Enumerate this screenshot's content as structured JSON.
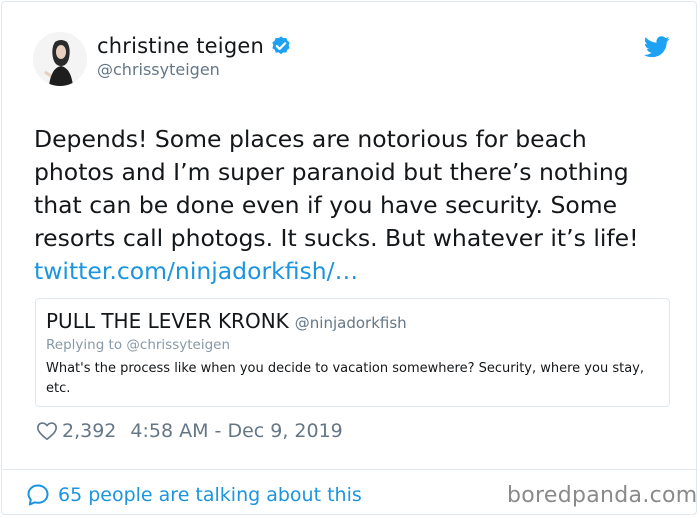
{
  "author": {
    "display_name": "christine teigen",
    "handle": "@chrissyteigen"
  },
  "tweet": {
    "text": "Depends! Some places are notorious for beach photos and I’m super paranoid but there’s nothing that can be done even if you have security. Some resorts call photogs. It sucks. But whatever it’s life!",
    "link": "twitter.com/ninjadorkfish/…"
  },
  "quote": {
    "display_name": "PULL THE LEVER KRONK",
    "handle": "@ninjadorkfish",
    "replying_to": "Replying to @chrissyteigen",
    "text": "What's the process like when you decide to vacation somewhere? Security, where you stay, etc."
  },
  "meta": {
    "likes": "2,392",
    "timestamp": "4:58 AM - Dec 9, 2019"
  },
  "footer": {
    "talking": "65 people are talking about this"
  },
  "watermark": "boredpanda.com",
  "colors": {
    "link_blue": "#1b95e0",
    "twitter_blue": "#1da1f2",
    "muted": "#657786"
  },
  "icons": [
    "avatar",
    "verified-badge-icon",
    "twitter-bird-icon",
    "heart-icon",
    "speech-bubble-icon"
  ]
}
